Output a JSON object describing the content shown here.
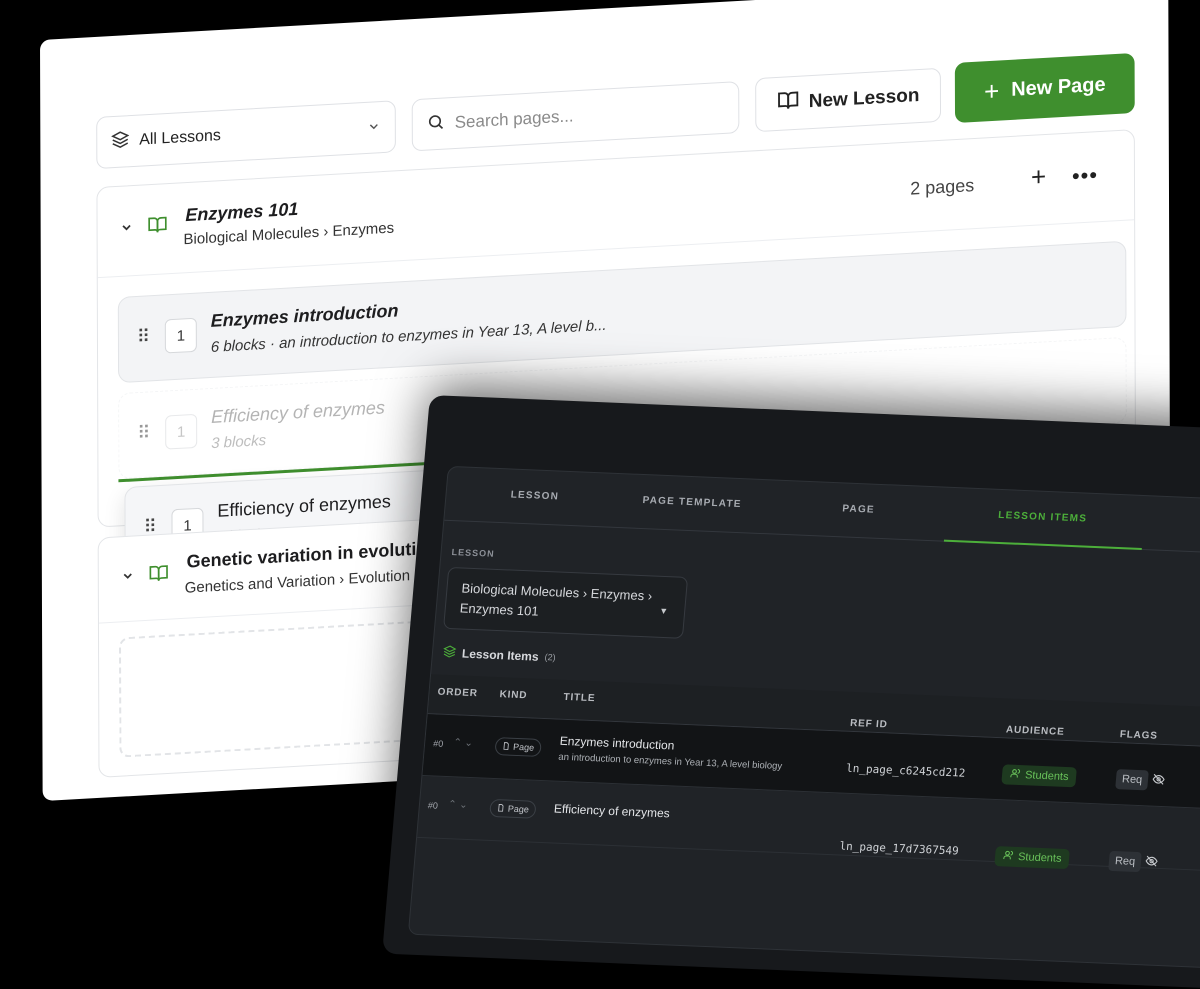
{
  "toolbar": {
    "lesson_filter": "All Lessons",
    "search_placeholder": "Search pages...",
    "new_lesson_label": "New Lesson",
    "new_page_label": "New Page",
    "accent_color": "#3f8f2e"
  },
  "lesson_groups": [
    {
      "title": "Enzymes 101",
      "path": "Biological Molecules › Enzymes",
      "page_count": "2 pages",
      "pages": [
        {
          "order": "1",
          "title": "Enzymes introduction",
          "meta": "6 blocks  ·  an introduction to enzymes in Year 13, A level b..."
        },
        {
          "order": "1",
          "title": "Efficiency of enzymes",
          "meta": "3 blocks"
        },
        {
          "order": "1",
          "title": "Efficiency of enzymes",
          "meta": "3 blocks"
        }
      ]
    },
    {
      "title": "Genetic variation in evolution",
      "path": "Genetics and Variation › Evolution"
    }
  ],
  "editor": {
    "tabs": [
      "LESSON",
      "PAGE TEMPLATE",
      "PAGE",
      "LESSON ITEMS"
    ],
    "active_tab": "LESSON ITEMS",
    "lesson_label": "LESSON",
    "lesson_value_line1": "Biological Molecules › Enzymes ›",
    "lesson_value_line2": "Enzymes 101",
    "items_title": "Lesson Items",
    "items_count": "(2)",
    "columns": {
      "order": "ORDER",
      "kind": "KIND",
      "title": "TITLE",
      "ref_id": "REF ID",
      "audience": "AUDIENCE",
      "flags": "FLAGS"
    },
    "rows": [
      {
        "order": "#0",
        "kind": "Page",
        "title": "Enzymes introduction",
        "subtitle": "an introduction to enzymes in Year 13, A level biology",
        "ref_id": "ln_page_c6245cd212",
        "audience": "Students",
        "flag": "Req"
      },
      {
        "order": "#0",
        "kind": "Page",
        "title": "Efficiency of enzymes",
        "subtitle": "",
        "ref_id": "ln_page_17d7367549",
        "audience": "Students",
        "flag": "Req"
      }
    ],
    "accent_color": "#4caf3a"
  }
}
